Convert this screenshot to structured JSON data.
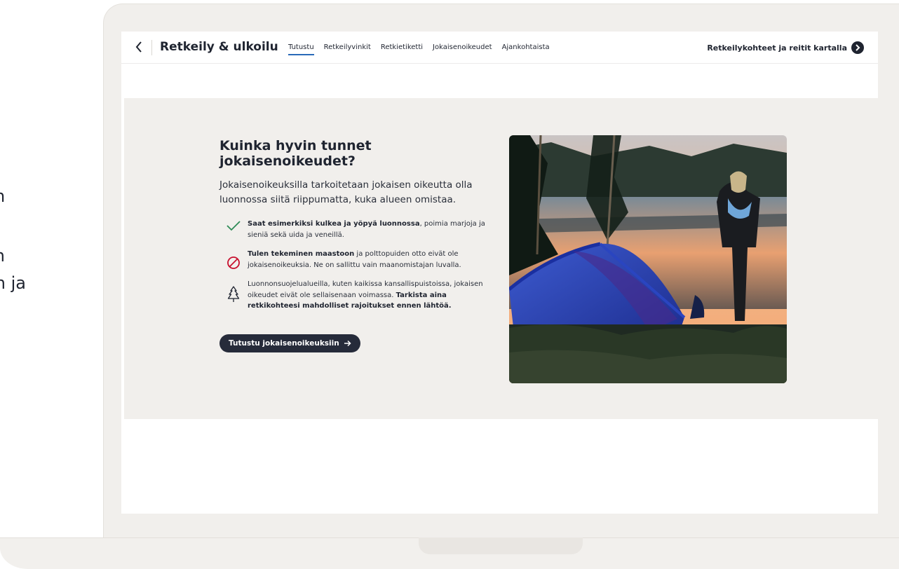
{
  "left_fragments": [
    "n",
    "an",
    "en ja"
  ],
  "header": {
    "back_icon": "chevron-left-icon",
    "title": "Retkeily & ulkoilu",
    "tabs": [
      {
        "label": "Tutustu",
        "active": true
      },
      {
        "label": "Retkeilyvinkit",
        "active": false
      },
      {
        "label": "Retkietiketti",
        "active": false
      },
      {
        "label": "Jokaisenoikeudet",
        "active": false
      },
      {
        "label": "Ajankohtaista",
        "active": false
      }
    ],
    "map_link": "Retkeilykohteet ja reitit kartalla",
    "map_link_icon": "arrow-right-circle-icon"
  },
  "main": {
    "heading_line1": "Kuinka hyvin tunnet",
    "heading_line2": "jokaisenoikeudet?",
    "lead": "Jokaisenoikeuksilla tarkoitetaan jokaisen oikeutta olla luonnossa siitä riippumatta, kuka alueen omistaa.",
    "facts": [
      {
        "icon": "checkmark-icon",
        "bold": "Saat esimerkiksi kulkea ja yöpyä luonnossa",
        "rest": ", poimia marjoja ja sieniä sekä uida ja veneillä."
      },
      {
        "icon": "prohibited-icon",
        "bold": "Tulen tekeminen maastoon",
        "rest": " ja polttopuiden otto eivät ole jokaisenoikeuksia. Ne on sallittu vain maanomistajan luvalla."
      },
      {
        "icon": "tree-icon",
        "pre": "Luonnonsuojelualueilla, kuten kaikissa kansallispuistoissa, jokaisen oikeudet eivät ole sellaisenaan voimassa. ",
        "bold": "Tarkista aina retkikohteesi mahdolliset rajoitukset ennen lähtöä."
      }
    ],
    "cta_label": "Tutustu jokaisenoikeuksiin",
    "cta_icon": "arrow-right-icon",
    "photo_icon": "camping-photo"
  },
  "colors": {
    "accent_underline": "#2a6ab8",
    "check_green": "#2e8b57",
    "prohibited_red": "#c8102e",
    "dark": "#262b3a",
    "section_bg": "#f1efec"
  }
}
